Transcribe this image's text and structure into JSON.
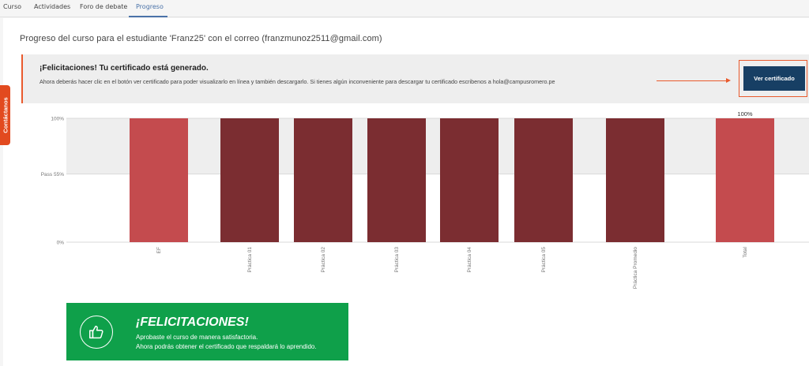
{
  "tabs": [
    {
      "label": "Curso",
      "active": false
    },
    {
      "label": "Actividades",
      "active": false
    },
    {
      "label": "Foro de debate",
      "active": false
    },
    {
      "label": "Progreso",
      "active": true
    }
  ],
  "side_tab": {
    "label": "Contáctanos",
    "color": "#e24a1f"
  },
  "page_title": "Progreso del curso para el estudiante 'Franz25' con el correo (franzmunoz2511@gmail.com)",
  "banner": {
    "title": "¡Felicitaciones! Tu certificado está generado.",
    "body": "Ahora deberás hacer clic en el botón ver certificado para poder visualizarlo en línea y también descargarlo. Si tienes algún inconveniente para descargar tu certificado escribenos a hola@campusromero.pe",
    "button_label": "Ver certificado",
    "accent_color": "#e95a2d",
    "button_color": "#173f64"
  },
  "chart_data": {
    "type": "bar",
    "categories": [
      "EF",
      "Práctica 01",
      "Práctica 02",
      "Práctica 03",
      "Práctica 04",
      "Práctica 05",
      "Práctica Promedio",
      "Total"
    ],
    "values": [
      100,
      100,
      100,
      100,
      100,
      100,
      100,
      100
    ],
    "colors": [
      "#c44b4e",
      "#7b2d31",
      "#7b2d31",
      "#7b2d31",
      "#7b2d31",
      "#7b2d31",
      "#7b2d31",
      "#c44b4e"
    ],
    "y_ticks": [
      {
        "value": 100,
        "label": "100%"
      },
      {
        "value": 55,
        "label": "Pass 55%"
      },
      {
        "value": 0,
        "label": "0%"
      }
    ],
    "pass_value": 55,
    "ylim": [
      0,
      100
    ],
    "data_labels": [
      {
        "category": "Total",
        "label": "100%"
      }
    ],
    "xlabel": "",
    "ylabel": ""
  },
  "congrats": {
    "title": "¡FELICITACIONES!",
    "line1": "Aprobaste el curso de manera satisfactoria.",
    "line2": "Ahora podrás obtener el certificado que respaldará lo aprendido.",
    "icon": "thumbs-up-icon",
    "color": "#0fa04a"
  }
}
